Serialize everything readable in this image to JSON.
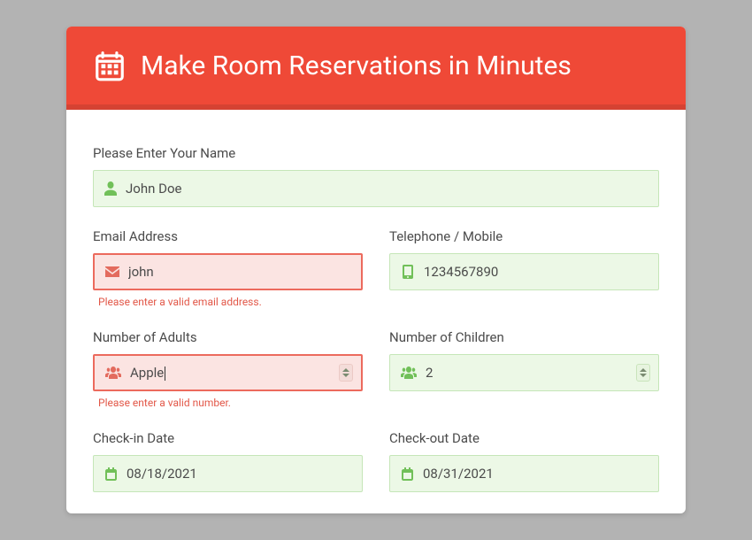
{
  "header": {
    "title": "Make Room Reservations in Minutes"
  },
  "fields": {
    "name": {
      "label": "Please Enter Your Name",
      "value": "John Doe"
    },
    "email": {
      "label": "Email Address",
      "value": "john",
      "error": "Please enter a valid email address."
    },
    "phone": {
      "label": "Telephone / Mobile",
      "value": "1234567890"
    },
    "adults": {
      "label": "Number of Adults",
      "value": "Apple",
      "error": "Please enter a valid number."
    },
    "children": {
      "label": "Number of Children",
      "value": "2"
    },
    "checkin": {
      "label": "Check-in Date",
      "value": "08/18/2021"
    },
    "checkout": {
      "label": "Check-out Date",
      "value": "08/31/2021"
    }
  }
}
